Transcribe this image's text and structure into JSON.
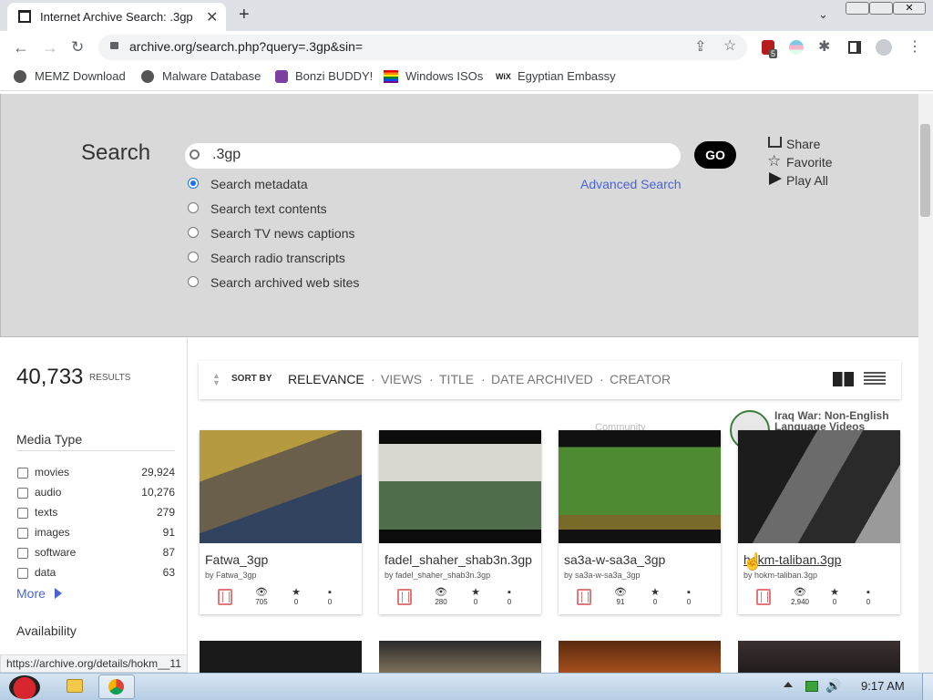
{
  "browser": {
    "tab_title": "Internet Archive Search: .3gp",
    "url": "archive.org/search.php?query=.3gp&sin=",
    "extension_badge": "5",
    "bookmarks": [
      {
        "label": "MEMZ Download"
      },
      {
        "label": "Malware Database"
      },
      {
        "label": "Bonzi BUDDY!"
      },
      {
        "label": "Windows ISOs"
      },
      {
        "label": "Egyptian Embassy"
      }
    ],
    "status_url": "https://archive.org/details/hokm__11"
  },
  "search": {
    "heading": "Search",
    "query": ".3gp",
    "go_label": "GO",
    "advanced_label": "Advanced Search",
    "options": [
      {
        "label": "Search metadata",
        "selected": true
      },
      {
        "label": "Search text contents",
        "selected": false
      },
      {
        "label": "Search TV news captions",
        "selected": false
      },
      {
        "label": "Search radio transcripts",
        "selected": false
      },
      {
        "label": "Search archived web sites",
        "selected": false
      }
    ],
    "actions": {
      "share": "Share",
      "favorite": "Favorite",
      "play_all": "Play All"
    }
  },
  "results": {
    "count": "40,733",
    "count_label": "RESULTS"
  },
  "facets": {
    "media_type_heading": "Media Type",
    "items": [
      {
        "label": "movies",
        "count": "29,924"
      },
      {
        "label": "audio",
        "count": "10,276"
      },
      {
        "label": "texts",
        "count": "279"
      },
      {
        "label": "images",
        "count": "91"
      },
      {
        "label": "software",
        "count": "87"
      },
      {
        "label": "data",
        "count": "63"
      }
    ],
    "more_label": "More",
    "availability_heading": "Availability"
  },
  "sort": {
    "label": "SORT BY",
    "options": [
      "RELEVANCE",
      "VIEWS",
      "TITLE",
      "DATE ARCHIVED",
      "CREATOR"
    ],
    "separator": "·"
  },
  "collection_tile": {
    "title": "Iraq War: Non-English Language Videos",
    "partial_label": "Community"
  },
  "cards": [
    {
      "title": "Fatwa_3gp",
      "by": "by Fatwa_3gp",
      "views": "705",
      "favs": "0",
      "reviews": "0"
    },
    {
      "title": "fadel_shaher_shab3n.3gp",
      "by": "by fadel_shaher_shab3n.3gp",
      "views": "280",
      "favs": "0",
      "reviews": "0"
    },
    {
      "title": "sa3a-w-sa3a_3gp",
      "by": "by sa3a-w-sa3a_3gp",
      "views": "91",
      "favs": "0",
      "reviews": "0"
    },
    {
      "title": "hokm-taliban.3gp",
      "by": "by hokm-taliban.3gp",
      "views": "2,940",
      "favs": "0",
      "reviews": "0"
    }
  ],
  "taskbar": {
    "clock": "9:17 AM"
  }
}
